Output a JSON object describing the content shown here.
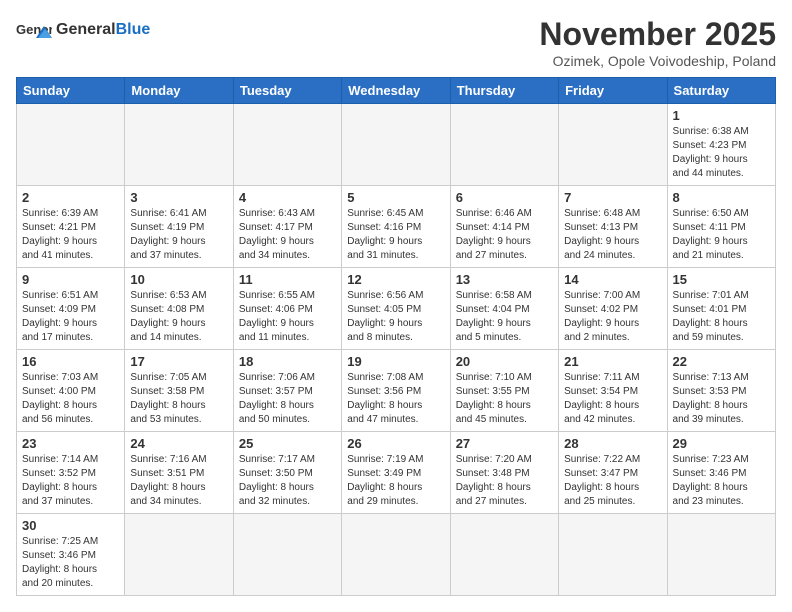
{
  "header": {
    "logo_general": "General",
    "logo_blue": "Blue",
    "month_title": "November 2025",
    "subtitle": "Ozimek, Opole Voivodeship, Poland"
  },
  "days_of_week": [
    "Sunday",
    "Monday",
    "Tuesday",
    "Wednesday",
    "Thursday",
    "Friday",
    "Saturday"
  ],
  "weeks": [
    [
      {
        "day": "",
        "info": ""
      },
      {
        "day": "",
        "info": ""
      },
      {
        "day": "",
        "info": ""
      },
      {
        "day": "",
        "info": ""
      },
      {
        "day": "",
        "info": ""
      },
      {
        "day": "",
        "info": ""
      },
      {
        "day": "1",
        "info": "Sunrise: 6:38 AM\nSunset: 4:23 PM\nDaylight: 9 hours\nand 44 minutes."
      }
    ],
    [
      {
        "day": "2",
        "info": "Sunrise: 6:39 AM\nSunset: 4:21 PM\nDaylight: 9 hours\nand 41 minutes."
      },
      {
        "day": "3",
        "info": "Sunrise: 6:41 AM\nSunset: 4:19 PM\nDaylight: 9 hours\nand 37 minutes."
      },
      {
        "day": "4",
        "info": "Sunrise: 6:43 AM\nSunset: 4:17 PM\nDaylight: 9 hours\nand 34 minutes."
      },
      {
        "day": "5",
        "info": "Sunrise: 6:45 AM\nSunset: 4:16 PM\nDaylight: 9 hours\nand 31 minutes."
      },
      {
        "day": "6",
        "info": "Sunrise: 6:46 AM\nSunset: 4:14 PM\nDaylight: 9 hours\nand 27 minutes."
      },
      {
        "day": "7",
        "info": "Sunrise: 6:48 AM\nSunset: 4:13 PM\nDaylight: 9 hours\nand 24 minutes."
      },
      {
        "day": "8",
        "info": "Sunrise: 6:50 AM\nSunset: 4:11 PM\nDaylight: 9 hours\nand 21 minutes."
      }
    ],
    [
      {
        "day": "9",
        "info": "Sunrise: 6:51 AM\nSunset: 4:09 PM\nDaylight: 9 hours\nand 17 minutes."
      },
      {
        "day": "10",
        "info": "Sunrise: 6:53 AM\nSunset: 4:08 PM\nDaylight: 9 hours\nand 14 minutes."
      },
      {
        "day": "11",
        "info": "Sunrise: 6:55 AM\nSunset: 4:06 PM\nDaylight: 9 hours\nand 11 minutes."
      },
      {
        "day": "12",
        "info": "Sunrise: 6:56 AM\nSunset: 4:05 PM\nDaylight: 9 hours\nand 8 minutes."
      },
      {
        "day": "13",
        "info": "Sunrise: 6:58 AM\nSunset: 4:04 PM\nDaylight: 9 hours\nand 5 minutes."
      },
      {
        "day": "14",
        "info": "Sunrise: 7:00 AM\nSunset: 4:02 PM\nDaylight: 9 hours\nand 2 minutes."
      },
      {
        "day": "15",
        "info": "Sunrise: 7:01 AM\nSunset: 4:01 PM\nDaylight: 8 hours\nand 59 minutes."
      }
    ],
    [
      {
        "day": "16",
        "info": "Sunrise: 7:03 AM\nSunset: 4:00 PM\nDaylight: 8 hours\nand 56 minutes."
      },
      {
        "day": "17",
        "info": "Sunrise: 7:05 AM\nSunset: 3:58 PM\nDaylight: 8 hours\nand 53 minutes."
      },
      {
        "day": "18",
        "info": "Sunrise: 7:06 AM\nSunset: 3:57 PM\nDaylight: 8 hours\nand 50 minutes."
      },
      {
        "day": "19",
        "info": "Sunrise: 7:08 AM\nSunset: 3:56 PM\nDaylight: 8 hours\nand 47 minutes."
      },
      {
        "day": "20",
        "info": "Sunrise: 7:10 AM\nSunset: 3:55 PM\nDaylight: 8 hours\nand 45 minutes."
      },
      {
        "day": "21",
        "info": "Sunrise: 7:11 AM\nSunset: 3:54 PM\nDaylight: 8 hours\nand 42 minutes."
      },
      {
        "day": "22",
        "info": "Sunrise: 7:13 AM\nSunset: 3:53 PM\nDaylight: 8 hours\nand 39 minutes."
      }
    ],
    [
      {
        "day": "23",
        "info": "Sunrise: 7:14 AM\nSunset: 3:52 PM\nDaylight: 8 hours\nand 37 minutes."
      },
      {
        "day": "24",
        "info": "Sunrise: 7:16 AM\nSunset: 3:51 PM\nDaylight: 8 hours\nand 34 minutes."
      },
      {
        "day": "25",
        "info": "Sunrise: 7:17 AM\nSunset: 3:50 PM\nDaylight: 8 hours\nand 32 minutes."
      },
      {
        "day": "26",
        "info": "Sunrise: 7:19 AM\nSunset: 3:49 PM\nDaylight: 8 hours\nand 29 minutes."
      },
      {
        "day": "27",
        "info": "Sunrise: 7:20 AM\nSunset: 3:48 PM\nDaylight: 8 hours\nand 27 minutes."
      },
      {
        "day": "28",
        "info": "Sunrise: 7:22 AM\nSunset: 3:47 PM\nDaylight: 8 hours\nand 25 minutes."
      },
      {
        "day": "29",
        "info": "Sunrise: 7:23 AM\nSunset: 3:46 PM\nDaylight: 8 hours\nand 23 minutes."
      }
    ],
    [
      {
        "day": "30",
        "info": "Sunrise: 7:25 AM\nSunset: 3:46 PM\nDaylight: 8 hours\nand 20 minutes."
      },
      {
        "day": "",
        "info": ""
      },
      {
        "day": "",
        "info": ""
      },
      {
        "day": "",
        "info": ""
      },
      {
        "day": "",
        "info": ""
      },
      {
        "day": "",
        "info": ""
      },
      {
        "day": "",
        "info": ""
      }
    ]
  ]
}
